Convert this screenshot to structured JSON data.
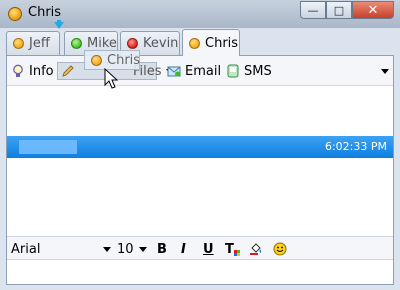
{
  "window": {
    "title": "Chris",
    "controls": {
      "minimize": "—",
      "maximize": "□",
      "close": "✕"
    }
  },
  "tabs": [
    {
      "label": "Jeff",
      "status_color": "#f3a51c",
      "active": false
    },
    {
      "label": "Mike",
      "status_color": "#3fbf1f",
      "active": false
    },
    {
      "label": "Kevin",
      "status_color": "#d81f1f",
      "active": false
    },
    {
      "label": "Chris",
      "status_color": "#f3a51c",
      "active": true
    }
  ],
  "drag_ghost": {
    "label": "Chris",
    "status_color": "#f3a51c"
  },
  "toolbar": {
    "info_label": "Info",
    "files_label": "Files",
    "email_label": "Email",
    "sms_label": "SMS"
  },
  "message": {
    "time": "6:02:33 PM",
    "highlight_color": "#1a8ae8"
  },
  "format": {
    "font_name": "Arial",
    "font_size": "10",
    "bold": "B",
    "italic": "I",
    "underline": "U",
    "text_color_glyph": "T"
  }
}
